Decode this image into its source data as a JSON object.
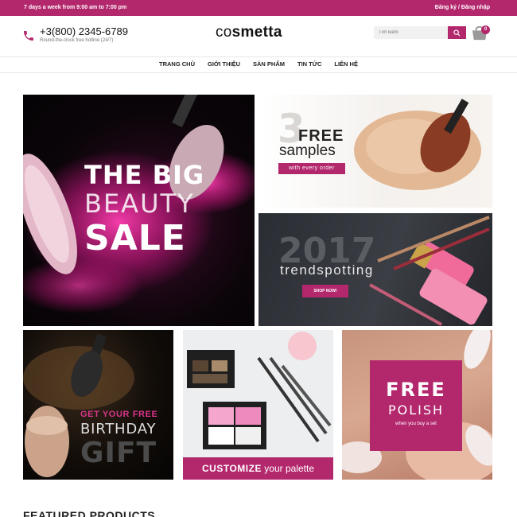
{
  "topbar": {
    "hours": "7 days a week from 9:00 am to 7:00 pm",
    "auth": "Đăng ký / Đăng nhập"
  },
  "header": {
    "phone": "+3(800) 2345-6789",
    "phone_sub": "Round-the-clock free hotline (24/7)",
    "logo_light": "co",
    "logo_bold": "smetta",
    "search_placeholder": "Tìm kiếm",
    "cart_count": "0"
  },
  "nav": [
    "TRANG CHỦ",
    "GIỚI THIỆU",
    "SẢN PHẨM",
    "TIN TỨC",
    "LIÊN HỆ"
  ],
  "banners": {
    "big": {
      "line1": "THE BIG",
      "line2": "BEAUTY",
      "line3": "SALE"
    },
    "free_samples": {
      "number": "3",
      "line1": "FREE",
      "line2": "samples",
      "badge": "with every order"
    },
    "trend": {
      "year": "2017",
      "word": "trendspotting",
      "button": "SHOP NOW!"
    },
    "gift": {
      "line1": "GET YOUR FREE",
      "line2": "BIRTHDAY",
      "line3": "GIFT"
    },
    "palette": {
      "bold": "CUSTOMIZE",
      "rest": " your palette"
    },
    "polish": {
      "line1": "FREE",
      "line2": "POLISH",
      "line3": "when you buy a set"
    }
  },
  "featured_title": "FEATURED PRODUCTS",
  "colors": {
    "brand": "#b3276d"
  }
}
